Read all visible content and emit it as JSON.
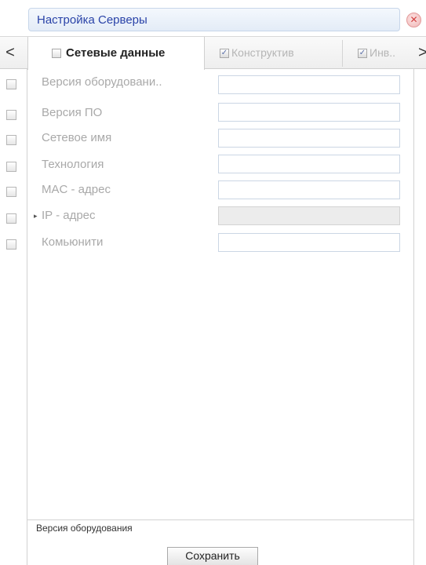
{
  "dialog": {
    "title": "Настройка Серверы",
    "close_icon": "close-icon"
  },
  "tabs": {
    "prev_label": "<",
    "next_label": ">",
    "items": [
      {
        "label": "Сетевые данные",
        "checked": false,
        "active": true
      },
      {
        "label": "Конструктив",
        "checked": true,
        "active": false
      },
      {
        "label": "Инв..",
        "checked": true,
        "active": false
      }
    ]
  },
  "fields": [
    {
      "label": "Версия оборудовани..",
      "value": "",
      "enabled": true
    },
    {
      "label": "Версия ПО",
      "value": "",
      "enabled": true
    },
    {
      "label": "Сетевое имя",
      "value": "",
      "enabled": true
    },
    {
      "label": "Технология",
      "value": "",
      "enabled": true
    },
    {
      "label": "MAC - адрес",
      "value": "",
      "enabled": true
    },
    {
      "label": "IP - адрес",
      "value": "",
      "enabled": false,
      "marker": "▸"
    },
    {
      "label": "Комьюнити",
      "value": "",
      "enabled": true
    }
  ],
  "status": {
    "text": "Версия оборудования"
  },
  "footer": {
    "save_label": "Сохранить"
  },
  "colors": {
    "title_text": "#2a43a8",
    "label_text": "#a9a9a9",
    "close_icon": "#d23c3c"
  }
}
